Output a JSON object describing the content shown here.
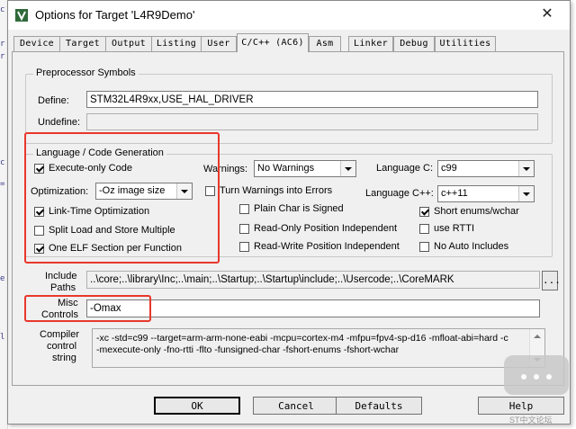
{
  "window": {
    "title": "Options for Target 'L4R9Demo'",
    "close_glyph": "✕"
  },
  "tabs": [
    {
      "label": "Device"
    },
    {
      "label": "Target"
    },
    {
      "label": "Output"
    },
    {
      "label": "Listing"
    },
    {
      "label": "User"
    },
    {
      "label": "C/C++ (AC6)"
    },
    {
      "label": "Asm"
    },
    {
      "label": "Linker"
    },
    {
      "label": "Debug"
    },
    {
      "label": "Utilities"
    }
  ],
  "active_tab": "C/C++ (AC6)",
  "preprocessor": {
    "title": "Preprocessor Symbols",
    "define_label": "Define:",
    "define_value": "STM32L4R9xx,USE_HAL_DRIVER",
    "undefine_label": "Undefine:",
    "undefine_value": ""
  },
  "language": {
    "title": "Language / Code Generation",
    "execute_only": "Execute-only Code",
    "optimization_label": "Optimization:",
    "optimization_value": "-Oz image size",
    "link_time": "Link-Time Optimization",
    "split_load": "Split Load and Store Multiple",
    "one_elf": "One ELF Section per Function",
    "warnings_label": "Warnings:",
    "warnings_value": "No Warnings",
    "turn_warnings": "Turn Warnings into Errors",
    "plain_char": "Plain Char is Signed",
    "ropi": "Read-Only Position Independent",
    "rwpi": "Read-Write Position Independent",
    "lang_c_label": "Language C:",
    "lang_c_value": "c99",
    "lang_cpp_label": "Language C++:",
    "lang_cpp_value": "c++11",
    "short_enums": "Short enums/wchar",
    "use_rtti": "use RTTI",
    "no_auto_includes": "No Auto Includes"
  },
  "checks": {
    "execute_only": true,
    "link_time": true,
    "split_load": false,
    "one_elf": true,
    "turn_warnings": false,
    "plain_char": false,
    "ropi": false,
    "rwpi": false,
    "short_enums": true,
    "use_rtti": false,
    "no_auto_includes": false
  },
  "include": {
    "label_line1": "Include",
    "label_line2": "Paths",
    "value": "..\\core;..\\library\\Inc;..\\main;..\\Startup;..\\Startup\\include;..\\Usercode;..\\CoreMARK",
    "browse": "..."
  },
  "misc": {
    "label_line1": "Misc",
    "label_line2": "Controls",
    "value": "-Omax"
  },
  "compiler": {
    "label_line1": "Compiler",
    "label_line2": "control",
    "label_line3": "string",
    "line1": "-xc -std=c99 --target=arm-arm-none-eabi -mcpu=cortex-m4 -mfpu=fpv4-sp-d16 -mfloat-abi=hard -c",
    "line2": "-mexecute-only -fno-rtti -flto -funsigned-char -fshort-enums -fshort-wchar"
  },
  "buttons": {
    "ok": "OK",
    "cancel": "Cancel",
    "defaults": "Defaults",
    "help": "Help"
  },
  "watermark": {
    "text": "ST中文论坛"
  },
  "colors": {
    "highlight_box": "#e8372c",
    "dialog_bg": "#f0f0f0"
  }
}
